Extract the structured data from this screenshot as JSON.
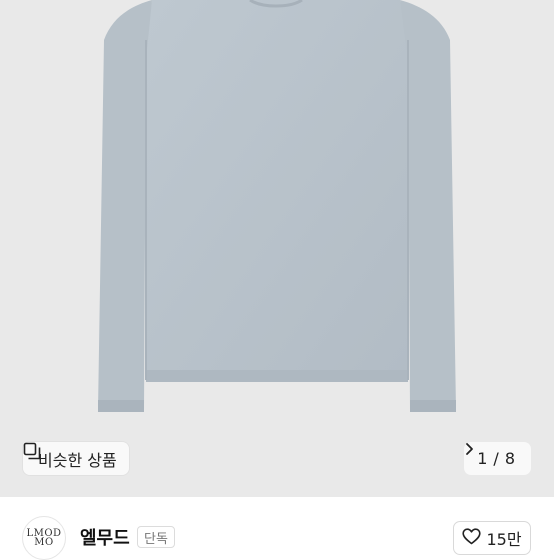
{
  "image": {
    "similar_label": "비슷한 상품",
    "page_current": "1",
    "page_separator": "/",
    "page_total": "8",
    "background_color": "#e9e9e9",
    "product_color": "#b9c3cb"
  },
  "seller": {
    "avatar_logo_line1": "LMOD",
    "avatar_logo_line2": "MO",
    "name": "엘무드",
    "badge": "단독",
    "likes": "15만"
  },
  "icons": {
    "similar": "similar-items-icon",
    "next": "chevron-right-icon",
    "like": "heart-outline-icon"
  }
}
